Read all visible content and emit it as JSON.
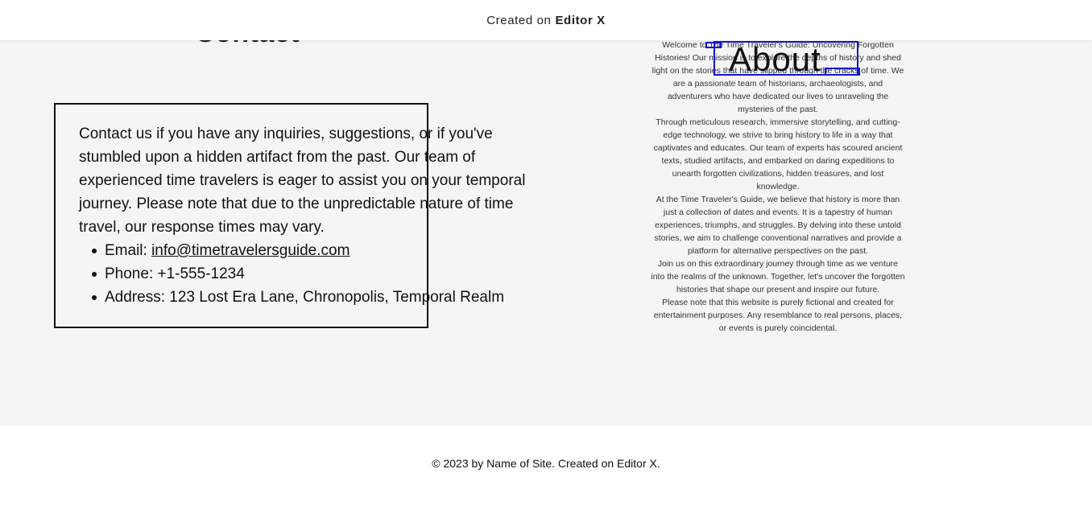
{
  "top_bar": {
    "prefix": "Created on",
    "brand": "Editor X"
  },
  "contact": {
    "heading": "Contact",
    "intro": "Contact us if you have any inquiries, suggestions, or if you've stumbled upon a hidden artifact from the past. Our team of experienced time travelers is eager to assist you on your temporal journey. Please note that due to the unpredictable nature of time travel, our response times may vary.",
    "email_label": "Email: ",
    "email": "info@timetravelersguide.com",
    "phone": "Phone: +1-555-1234",
    "address": "Address: 123 Lost Era Lane, Chronopolis, Temporal Realm"
  },
  "about": {
    "heading": "About",
    "paragraphs": [
      "Welcome to The Time Traveler's Guide: Uncovering Forgotten Histories! Our mission is to explore the depths of history and shed light on the stories that have slipped through the cracks of time. We are a passionate team of historians, archaeologists, and adventurers who have dedicated our lives to unraveling the mysteries of the past.",
      "Through meticulous research, immersive storytelling, and cutting-edge technology, we strive to bring history to life in a way that captivates and educates. Our team of experts has scoured ancient texts, studied artifacts, and embarked on daring expeditions to unearth forgotten civilizations, hidden treasures, and lost knowledge.",
      "At the Time Traveler's Guide, we believe that history is more than just a collection of dates and events. It is a tapestry of human experiences, triumphs, and struggles. By delving into these untold stories, we aim to challenge conventional narratives and provide a platform for alternative perspectives on the past.",
      "Join us on this extraordinary journey through time as we venture into the realms of the unknown. Together, let's uncover the forgotten histories that shape our present and inspire our future.",
      "Please note that this website is purely fictional and created for entertainment purposes. Any resemblance to real persons, places, or events is purely coincidental."
    ]
  },
  "footer": {
    "text": "© 2023 by Name of Site. Created on Editor X."
  },
  "colors": {
    "selection_outline": "#1515d6",
    "section_background": "#f5f5f5"
  }
}
